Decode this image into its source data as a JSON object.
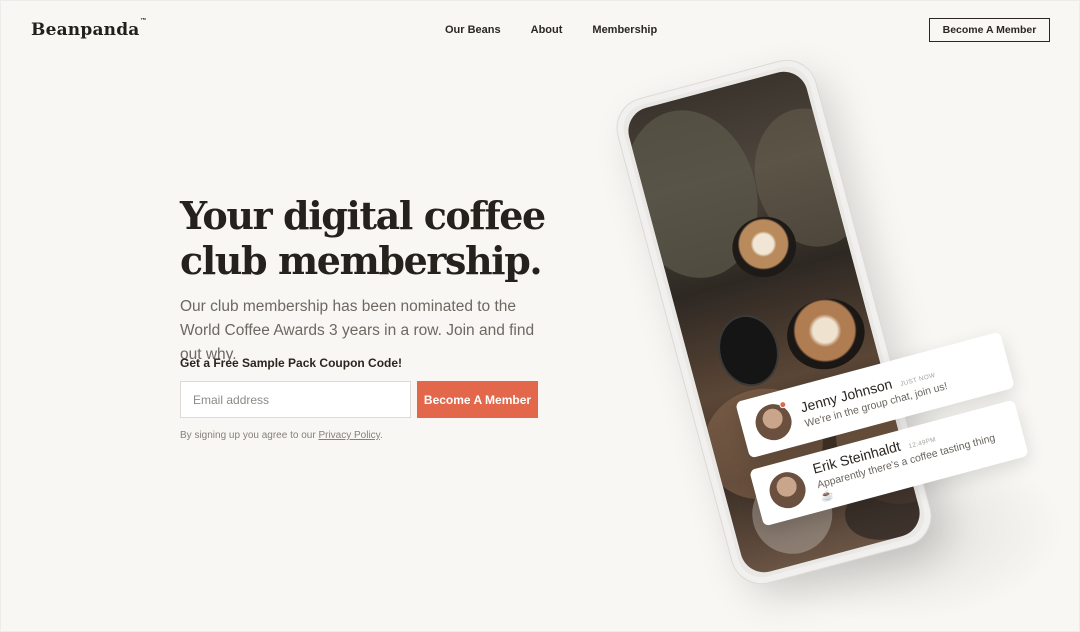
{
  "header": {
    "logo": "Beanpanda",
    "logo_mark": "™",
    "nav": [
      "Our Beans",
      "About",
      "Membership"
    ],
    "cta_label": "Become A Member"
  },
  "hero": {
    "title_line1": "Your digital coffee",
    "title_line2": "club membership.",
    "subtitle": "Our club membership has been nominated to the World Coffee Awards 3 years in a row. Join and find out why.",
    "coupon_label": "Get a Free Sample Pack Coupon Code!",
    "email_placeholder": "Email address",
    "cta_label": "Become A Member",
    "terms_prefix": "By signing up you agree to our ",
    "terms_link": "Privacy Policy",
    "terms_suffix": "."
  },
  "messages": [
    {
      "name": "Jenny Johnson",
      "time": "JUST NOW",
      "text": "We're in the group chat, join us!"
    },
    {
      "name": "Erik Steinhaldt",
      "time": "12:49PM",
      "text": "Apparently there's a coffee tasting thing ☕"
    }
  ],
  "colors": {
    "background": "#f8f7f3",
    "accent": "#e2674b",
    "text": "#2a2520"
  }
}
